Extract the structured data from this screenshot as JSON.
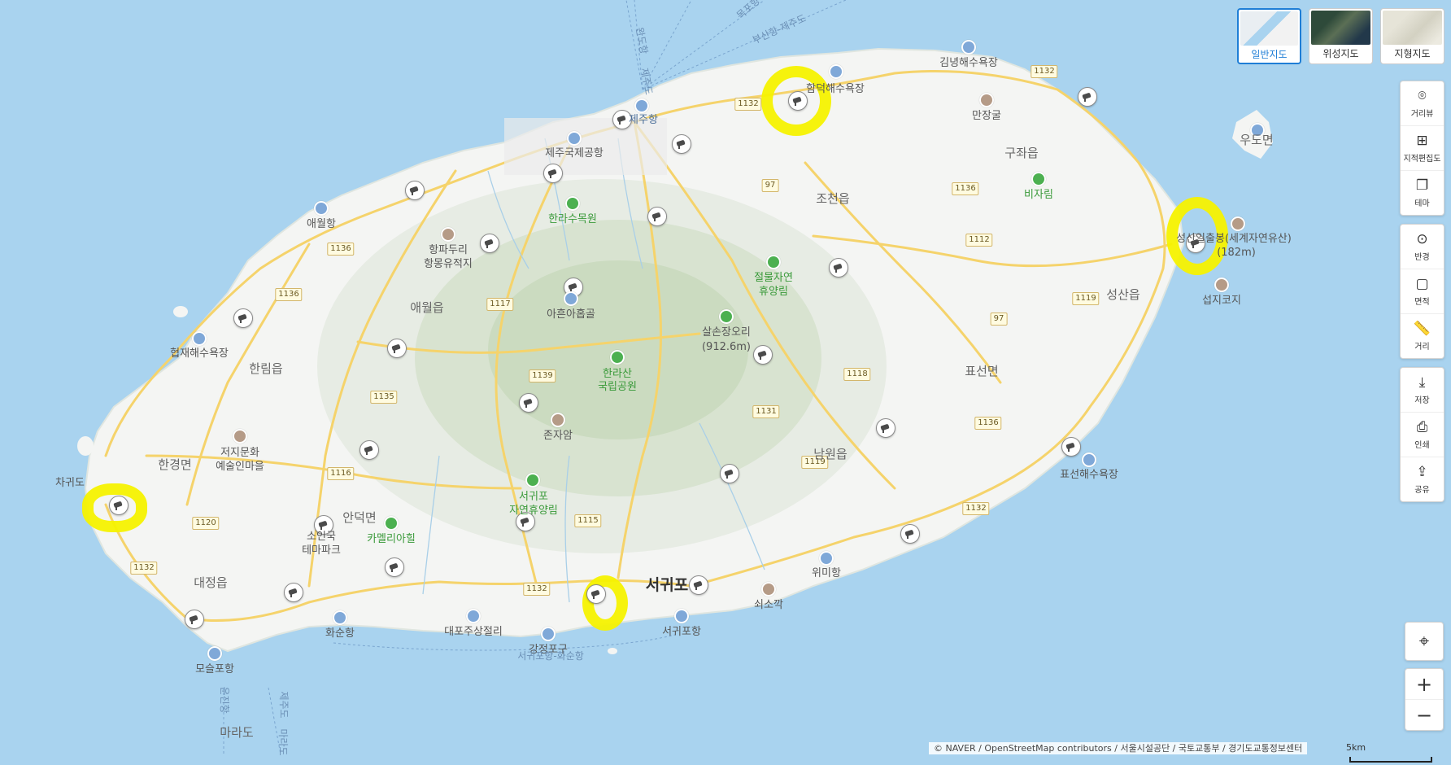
{
  "map_types": [
    {
      "label": "일반지도",
      "active": true
    },
    {
      "label": "위성지도",
      "active": false
    },
    {
      "label": "지형지도",
      "active": false
    }
  ],
  "tools": {
    "group1": [
      {
        "label": "거리뷰",
        "icon": "pin-icon"
      },
      {
        "label": "지적편집도",
        "icon": "grid-icon"
      },
      {
        "label": "테마",
        "icon": "layers-icon"
      }
    ],
    "group2": [
      {
        "label": "반경",
        "icon": "radius-icon"
      },
      {
        "label": "면적",
        "icon": "area-icon"
      },
      {
        "label": "거리",
        "icon": "ruler-icon"
      }
    ],
    "group3": [
      {
        "label": "저장",
        "icon": "download-icon"
      },
      {
        "label": "인쇄",
        "icon": "print-icon"
      },
      {
        "label": "공유",
        "icon": "share-icon"
      }
    ]
  },
  "controls": {
    "locate_icon": "crosshair-icon",
    "zoom_in": "+",
    "zoom_out": "−"
  },
  "attribution": "© NAVER / OpenStreetMap contributors / 서울시설공단 / 국토교통부 / 경기도교통정보센터",
  "scale": "5km",
  "labels": {
    "jeju_port": "제주항",
    "jeju_airport": "제주국제공항",
    "hamdeok_beach": "함덕해수욕장",
    "gimnyeong_beach": "김녕해수욕장",
    "manjanggul": "만장굴",
    "gujwa": "구좌읍",
    "bijarim": "비자림",
    "udo": "우도면",
    "seongsan_peak": "성산일출봉(세계자연유산)",
    "seongsan_height": "(182m)",
    "seopjikoji": "섭지코지",
    "seongsan": "성산읍",
    "pyoseon": "표선면",
    "pyoseon_beach": "표선해수욕장",
    "namwon": "남원읍",
    "wimi_port": "위미항",
    "soesokkak": "쇠소깍",
    "seogwipo": "서귀포",
    "seogwipo_port": "서귀포항",
    "gangjeong_port": "강정포구",
    "seogwipo_hwasun": "서귀포항-화순항",
    "daepo": "대포주상절리",
    "hwasun_port": "화순항",
    "moseulpo_port": "모슬포항",
    "marado": "마라도",
    "daejeong": "대정읍",
    "andeok": "안덕면",
    "soingook": "소인국",
    "themepark": "테마파크",
    "camellia": "카멜리아힐",
    "hangyeong": "한경면",
    "chagwido": "차귀도",
    "jeoji": "저지문화",
    "jeoji2": "예술인마을",
    "hallim": "한림읍",
    "hyeopjae": "협재해수욕장",
    "aewol_port": "애월항",
    "aewol": "애월읍",
    "hangpadori": "항파두리",
    "hangpadori2": "항몽유적지",
    "halla_arboretum": "한라수목원",
    "aheun": "아흔아홉골",
    "hallasan": "한라산",
    "hallasan2": "국립공원",
    "jonjaam": "존자암",
    "seogwipo_forest": "서귀포",
    "seogwipo_forest2": "자연휴양림",
    "jeolmul": "절물자연",
    "jeolmul2": "휴양림",
    "salsonjang": "살손장오리",
    "salsonjang2": "(912.6m)",
    "jocheon": "조천읍",
    "busan_ferry": "부산항-제주도",
    "wando_ferry": "완도항",
    "mokpo_ferry": "목포항",
    "jeju_ferry": "제주도",
    "unjin_port": "운진항",
    "marado_ferry": "마라도"
  },
  "roads": [
    "1132",
    "1132",
    "97",
    "1136",
    "1112",
    "1119",
    "97",
    "1118",
    "1136",
    "1132",
    "1119",
    "1131",
    "1139",
    "1117",
    "1136",
    "1135",
    "1116",
    "1120",
    "1132",
    "1115",
    "1132"
  ],
  "highlights": [
    "hamdeok-cctv",
    "seongsan-cctv",
    "chagwido-cctv",
    "seogwipo-cctv"
  ]
}
